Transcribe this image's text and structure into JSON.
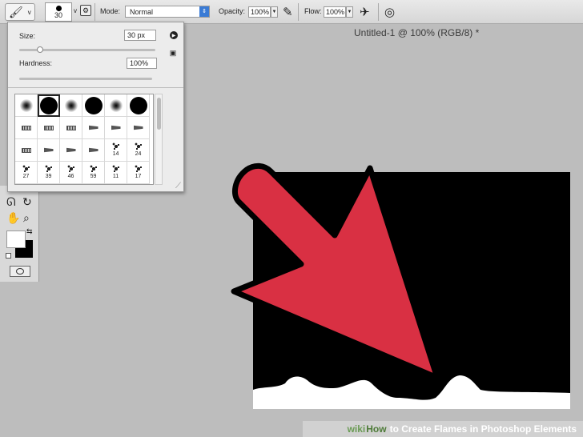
{
  "options_bar": {
    "tool_preset_caret": "v",
    "brush_size": "30",
    "mode_label": "Mode:",
    "mode_value": "Normal",
    "opacity_label": "Opacity:",
    "opacity_value": "100%",
    "flow_label": "Flow:",
    "flow_value": "100%"
  },
  "document": {
    "title": "Untitled-1 @ 100% (RGB/8) *"
  },
  "brush_popup": {
    "size_label": "Size:",
    "size_value": "30 px",
    "hardness_label": "Hardness:",
    "hardness_value": "100%",
    "size_slider_fraction": 0.15,
    "hardness_slider_fraction": 1.0,
    "brushes": [
      {
        "kind": "soft",
        "label": ""
      },
      {
        "kind": "hard",
        "label": "",
        "selected": true
      },
      {
        "kind": "soft",
        "label": ""
      },
      {
        "kind": "hard",
        "label": ""
      },
      {
        "kind": "soft",
        "label": ""
      },
      {
        "kind": "hard",
        "label": ""
      },
      {
        "kind": "chalk",
        "label": ""
      },
      {
        "kind": "chalk",
        "label": ""
      },
      {
        "kind": "chalk",
        "label": ""
      },
      {
        "kind": "wedge",
        "label": ""
      },
      {
        "kind": "wedge",
        "label": ""
      },
      {
        "kind": "wedge",
        "label": ""
      },
      {
        "kind": "chalk",
        "label": ""
      },
      {
        "kind": "wedge",
        "label": ""
      },
      {
        "kind": "wedge",
        "label": ""
      },
      {
        "kind": "wedge",
        "label": ""
      },
      {
        "kind": "splat",
        "label": "14"
      },
      {
        "kind": "splat",
        "label": "24"
      },
      {
        "kind": "splat",
        "label": "27"
      },
      {
        "kind": "splat",
        "label": "39"
      },
      {
        "kind": "splat",
        "label": "46"
      },
      {
        "kind": "splat",
        "label": "59"
      },
      {
        "kind": "splat",
        "label": "11"
      },
      {
        "kind": "splat",
        "label": "17"
      }
    ]
  },
  "colors": {
    "foreground": "#ffffff",
    "background": "#000000",
    "arrow": "#d93043",
    "canvas": "#000000"
  },
  "watermark": {
    "brand_a": "wiki",
    "brand_b": "How",
    "text": "to Create Flames in Photoshop Elements"
  }
}
